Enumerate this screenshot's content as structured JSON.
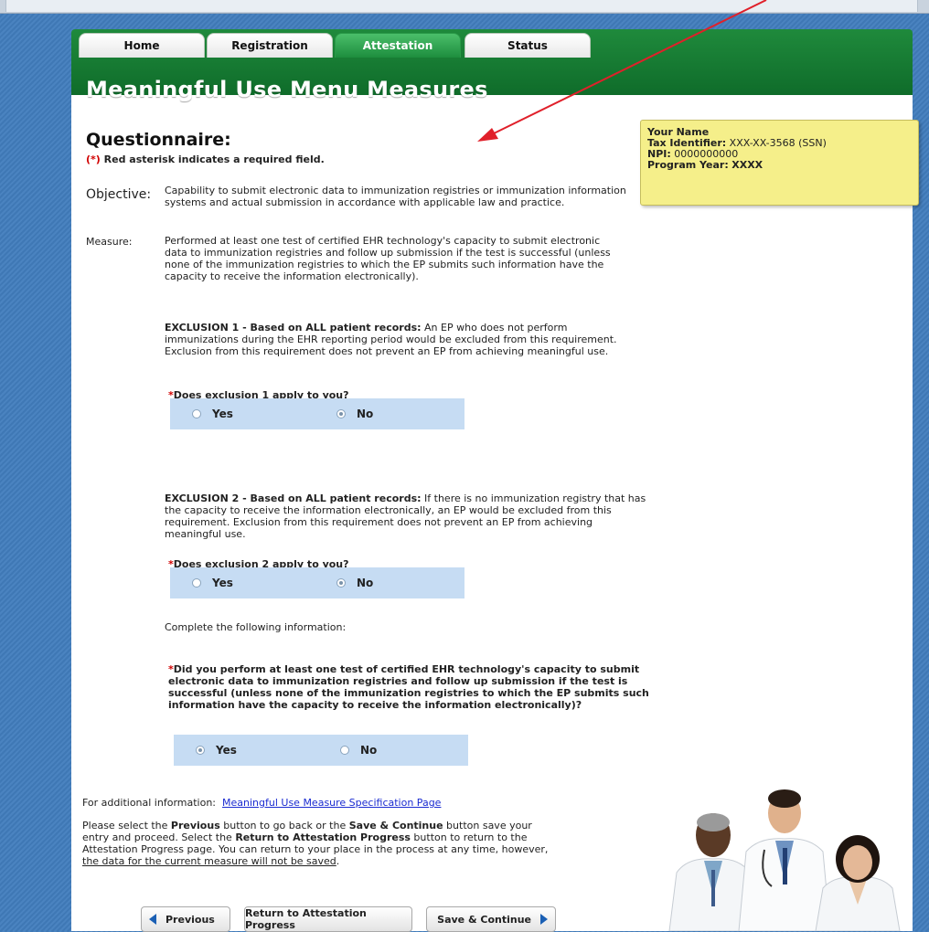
{
  "nav": {
    "tabs": [
      {
        "label": "Home"
      },
      {
        "label": "Registration"
      },
      {
        "label": "Attestation",
        "active": true
      },
      {
        "label": "Status"
      }
    ]
  },
  "page_title": "Meaningful Use Menu Measures",
  "info": {
    "name": "Your Name",
    "tax_label": "Tax Identifier:",
    "tax_value": "XXX-XX-3568 (SSN)",
    "npi_label": "NPI:",
    "npi_value": "0000000000",
    "year_label": "Program Year:",
    "year_value": "XXXX"
  },
  "questionnaire": {
    "title": "Questionnaire:",
    "required_marker": "(*)",
    "required_note": " Red asterisk indicates a required field."
  },
  "objective": {
    "label": "Objective:",
    "text": "Capability to submit electronic data to immunization registries or immunization information systems and actual submission in accordance with applicable law and practice."
  },
  "measure": {
    "label": "Measure:",
    "text": "Performed at least one test of certified EHR technology's capacity to submit electronic data to immunization registries and follow up submission if the test is successful (unless none of the immunization registries to which the EP submits such information have the capacity to receive the information electronically)."
  },
  "exclusion1": {
    "heading": "EXCLUSION 1 - Based on ALL patient records:",
    "text": " An EP who does not perform immunizations during the EHR reporting period would be excluded from this requirement. Exclusion from this requirement does not prevent an EP from achieving meaningful use.",
    "question": "Does exclusion 1 apply to you?",
    "yes": "Yes",
    "no": "No",
    "selected": "No"
  },
  "exclusion2": {
    "heading": "EXCLUSION 2 - Based on ALL patient records:",
    "text": " If there is no immunization registry that has the capacity to receive the information electronically, an EP would be excluded from this requirement. Exclusion from this requirement does not prevent an EP from achieving meaningful use.",
    "question": "Does exclusion 2 apply to you?",
    "yes": "Yes",
    "no": "No",
    "selected": "No"
  },
  "complete_info": "Complete the following information:",
  "main_question": {
    "text": "Did you perform at least one test of certified EHR technology's capacity to submit electronic data to immunization registries and follow up submission if the test is successful (unless none of the immunization registries to which the EP submits such information have the capacity to receive the information electronically)?",
    "yes": "Yes",
    "no": "No",
    "selected": "Yes"
  },
  "asterisk": "*",
  "additional": {
    "label": "For additional information:",
    "link": "Meaningful Use Measure Specification Page"
  },
  "instructions": {
    "p1": "Please select the ",
    "b1": "Previous",
    "p2": " button to go back or the ",
    "b2": "Save & Continue",
    "p3": " button save your entry and proceed. Select the ",
    "b3": "Return to Attestation Progress",
    "p4": " button to return to the Attestation Progress page. You can return to your place in the process at any time, however, ",
    "u1": "the data for the current measure will not be saved",
    "p5": "."
  },
  "buttons": {
    "previous": "Previous",
    "return": "Return to Attestation Progress",
    "save": "Save & Continue"
  },
  "colors": {
    "nav_green": "#1a7f36",
    "asterisk_red": "#d10000",
    "annotation_arrow": "#e0202a"
  }
}
